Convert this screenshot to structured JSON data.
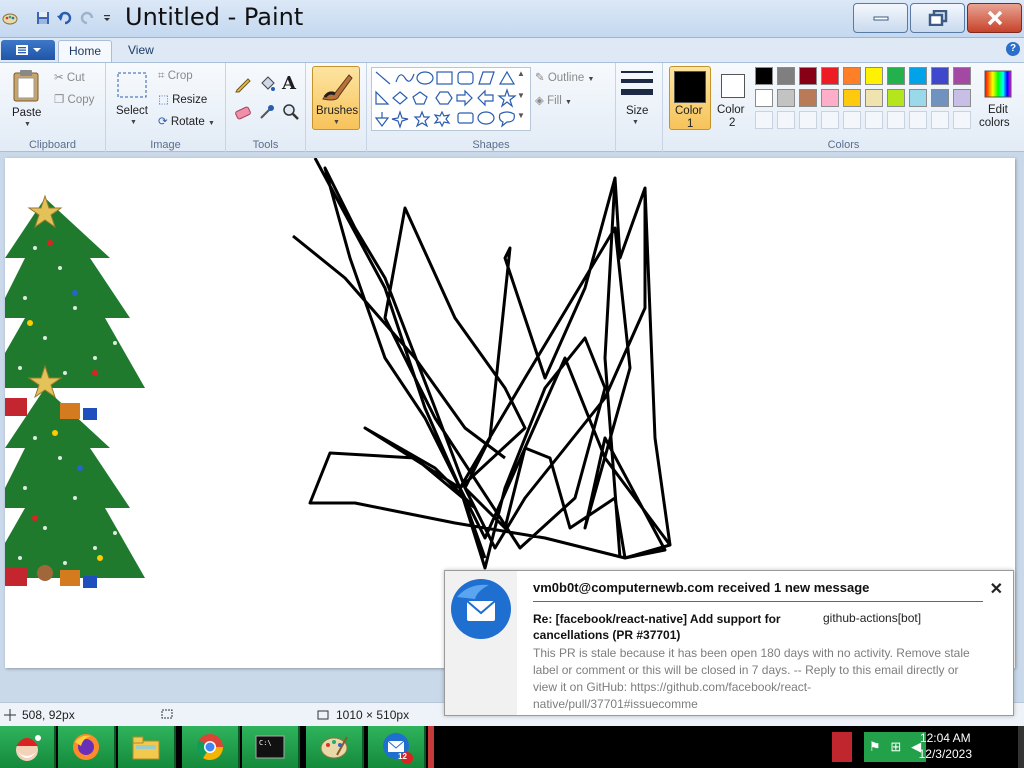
{
  "window": {
    "title": "Untitled - Paint"
  },
  "tabs": {
    "file_menu": "",
    "home": "Home",
    "view": "View"
  },
  "clipboard": {
    "paste": "Paste",
    "cut": "Cut",
    "copy": "Copy",
    "label": "Clipboard"
  },
  "image": {
    "select": "Select",
    "crop": "Crop",
    "resize": "Resize",
    "rotate": "Rotate",
    "label": "Image"
  },
  "tools": {
    "label": "Tools",
    "text_tool": "A"
  },
  "brushes": {
    "label": "Brushes"
  },
  "shapes": {
    "outline": "Outline",
    "fill": "Fill",
    "label": "Shapes"
  },
  "size": {
    "label": "Size"
  },
  "colors": {
    "color1_label": "Color\n1",
    "color1_line1": "Color",
    "color1_line2": "1",
    "color2_line1": "Color",
    "color2_line2": "2",
    "edit_line1": "Edit",
    "edit_line2": "colors",
    "label": "Colors",
    "color1": "#000000",
    "color2": "#ffffff",
    "palette_row1": [
      "#000000",
      "#7f7f7f",
      "#880015",
      "#ed1c24",
      "#ff7f27",
      "#fff200",
      "#22b14c",
      "#00a2e8",
      "#3f48cc",
      "#a349a4"
    ],
    "palette_row2": [
      "#ffffff",
      "#c3c3c3",
      "#b97a57",
      "#ffaec9",
      "#ffc90e",
      "#efe4b0",
      "#b5e61d",
      "#99d9ea",
      "#7092be",
      "#c8bfe7"
    ]
  },
  "status": {
    "cursor_pos": "508, 92px",
    "canvas_size": "1010 × 510px"
  },
  "clock": {
    "time": "12:04 AM",
    "date": "12/3/2023"
  },
  "taskbar": {
    "thunderbird_badge": "12"
  },
  "notification": {
    "header": "vm0b0t@computernewb.com received 1 new message",
    "subject": "Re: [facebook/react-native] Add support for cancellations (PR #37701)",
    "sender": "github-actions[bot]",
    "body": "This PR is stale because it has been open 180 days with no activity. Remove stale label or comment or this will be closed in 7 days. -- Reply to this email directly or view it on GitHub: https://github.com/facebook/react-native/pull/37701#issuecomme"
  }
}
